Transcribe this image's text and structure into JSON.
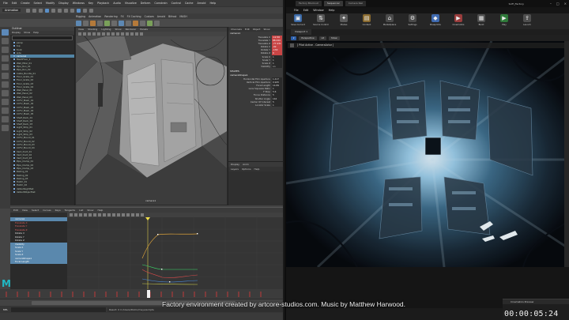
{
  "maya": {
    "menubar": [
      "File",
      "Edit",
      "Create",
      "Select",
      "Modify",
      "Display",
      "Windows",
      "Key",
      "Playback",
      "Audio",
      "Visualize",
      "Deform",
      "Constrain",
      "Control",
      "Cache",
      "Arnold",
      "Help"
    ],
    "mode_set": "Animation",
    "shelf_tabs": [
      "Rigging",
      "Animation",
      "Rendering",
      "FX",
      "FX Caching",
      "Custom",
      "Arnold",
      "Bifrost",
      "MASH"
    ],
    "outliner": {
      "title": "Outliner",
      "menu": [
        "Display",
        "Show",
        "Help"
      ],
      "rows": [
        {
          "label": "persp",
          "sel": false
        },
        {
          "label": "top",
          "sel": false
        },
        {
          "label": "front",
          "sel": false
        },
        {
          "label": "side",
          "sel": false
        },
        {
          "label": "camera1",
          "sel": true
        },
        {
          "label": "MeshFloor_1",
          "sel": false
        },
        {
          "label": "Wall_Pillar_01",
          "sel": false
        },
        {
          "label": "Pipe_Run_01",
          "sel": false
        },
        {
          "label": "Pipe_Run_02",
          "sel": false
        },
        {
          "label": "Cable_Bundle_01",
          "sel": false
        },
        {
          "label": "Floor_Grate_01",
          "sel": false
        },
        {
          "label": "Floor_Grate_02",
          "sel": false
        },
        {
          "label": "Floor_Grate_03",
          "sel": false
        },
        {
          "label": "Floor_Grate_04",
          "sel": false
        },
        {
          "label": "Wall_Panel_01",
          "sel": false
        },
        {
          "label": "Wall_Panel_02",
          "sel": false
        },
        {
          "label": "Wall_Panel_03",
          "sel": false
        },
        {
          "label": "CCTV_Mesh_01",
          "sel": false
        },
        {
          "label": "CCTV_Mesh_02",
          "sel": false
        },
        {
          "label": "CCTV_Mesh_03",
          "sel": false
        },
        {
          "label": "CCTV_Mesh_04",
          "sel": false
        },
        {
          "label": "CCTV_Mesh_05",
          "sel": false
        },
        {
          "label": "Shelf_Rack_01",
          "sel": false
        },
        {
          "label": "Shelf_Rack_02",
          "sel": false
        },
        {
          "label": "Shelf_Rack_03",
          "sel": false
        },
        {
          "label": "Light_Strip_01",
          "sel": false
        },
        {
          "label": "Light_Strip_02",
          "sel": false
        },
        {
          "label": "Light_Strip_03",
          "sel": false
        },
        {
          "label": "CCTV_Mount_01",
          "sel": false
        },
        {
          "label": "CCTV_Mount_02",
          "sel": false
        },
        {
          "label": "CCTV_Mount_03",
          "sel": false
        },
        {
          "label": "CCTV_Mount_04",
          "sel": false
        },
        {
          "label": "Vent_Duct_01",
          "sel": false
        },
        {
          "label": "Vent_Duct_02",
          "sel": false
        },
        {
          "label": "Vent_Duct_03",
          "sel": false
        },
        {
          "label": "Pipe_Clamp_01",
          "sel": false
        },
        {
          "label": "Pipe_Clamp_02",
          "sel": false
        },
        {
          "label": "Pipe_Clamp_03",
          "sel": false
        },
        {
          "label": "Railing_01",
          "sel": false
        },
        {
          "label": "Railing_02",
          "sel": false
        },
        {
          "label": "Railing_03",
          "sel": false
        },
        {
          "label": "Hatch_01",
          "sel": false
        },
        {
          "label": "Hatch_02",
          "sel": false
        },
        {
          "label": "defaultLightSet",
          "sel": false
        },
        {
          "label": "defaultObjectSet",
          "sel": false
        }
      ]
    },
    "viewport": {
      "menu": [
        "View",
        "Shading",
        "Lighting",
        "Show",
        "Renderer",
        "Panels"
      ],
      "camera_label": "camera1"
    },
    "channel_box": {
      "tabs": [
        "Channels",
        "Edit",
        "Object",
        "Show"
      ],
      "object": "camera1",
      "attrs": [
        {
          "name": "Translate X",
          "value": "-12.56",
          "key": true
        },
        {
          "name": "Translate Y",
          "value": "88.244",
          "key": true
        },
        {
          "name": "Translate Z",
          "value": "-77.231",
          "key": true
        },
        {
          "name": "Rotate X",
          "value": "-92",
          "key": true
        },
        {
          "name": "Rotate Y",
          "value": "-130",
          "key": true
        },
        {
          "name": "Rotate Z",
          "value": "0",
          "key": true
        },
        {
          "name": "Scale X",
          "value": "1",
          "key": false
        },
        {
          "name": "Scale Y",
          "value": "1",
          "key": false
        },
        {
          "name": "Scale Z",
          "value": "1",
          "key": false
        },
        {
          "name": "Visibility",
          "value": "on",
          "key": false
        }
      ],
      "shapes_label": "SHAPES",
      "shape_name": "cameraShape1",
      "shape_attrs": [
        {
          "name": "Horizontal Film Aperture",
          "value": "1.417"
        },
        {
          "name": "Vertical Film Aperture",
          "value": "0.945"
        },
        {
          "name": "Focal Length",
          "value": "14.89"
        },
        {
          "name": "Lens Squeeze Ratio",
          "value": "1"
        },
        {
          "name": "F Stop",
          "value": "5.6"
        },
        {
          "name": "Focus Distance",
          "value": "5"
        },
        {
          "name": "Shutter Angle",
          "value": "144"
        },
        {
          "name": "Center Of Interest",
          "value": "5"
        },
        {
          "name": "Locator Scale",
          "value": "1"
        }
      ],
      "layer_tabs": [
        "Display",
        "Anim"
      ],
      "layer_menu": [
        "Layers",
        "Options",
        "Help"
      ]
    },
    "graph_editor": {
      "menu": [
        "Edit",
        "View",
        "Select",
        "Curves",
        "Keys",
        "Tangents",
        "List",
        "Show",
        "Help"
      ],
      "rows": [
        {
          "label": "camera1",
          "style": "sel"
        },
        {
          "label": "Translate X",
          "style": "r"
        },
        {
          "label": "Translate Y",
          "style": "r"
        },
        {
          "label": "Translate Z",
          "style": "r"
        },
        {
          "label": "Rotate X",
          "style": ""
        },
        {
          "label": "Rotate Y",
          "style": ""
        },
        {
          "label": "Rotate Z",
          "style": ""
        },
        {
          "label": "Visibility",
          "style": "sel"
        },
        {
          "label": "Scale X",
          "style": "sel"
        },
        {
          "label": "Scale Y",
          "style": "sel"
        },
        {
          "label": "Scale Z",
          "style": "sel"
        },
        {
          "label": "cameraShape1",
          "style": "sel"
        },
        {
          "label": "Focal Length",
          "style": "sel"
        }
      ]
    },
    "command_result": "Result: 0 C:/Users/Public/maya/scripts",
    "logo": "M",
    "mel_label": "MEL"
  },
  "ue": {
    "tabs": [
      {
        "label": "Factory Blockout",
        "active": false
      },
      {
        "label": "Sequencer",
        "active": true
      },
      {
        "label": "Camera Rail",
        "active": false
      }
    ],
    "project": "SciFi_Factory",
    "menu": [
      "File",
      "Edit",
      "Window",
      "Help"
    ],
    "toolbar": [
      {
        "label": "Save Current",
        "icon": "save-icon",
        "color": "#3b6aa8",
        "glyph": "▣"
      },
      {
        "label": "Source Control",
        "icon": "source-control-icon",
        "color": "#555",
        "glyph": "⇅"
      },
      {
        "label": "Modes",
        "icon": "modes-icon",
        "color": "#5b5b5b",
        "glyph": "✦"
      },
      {
        "label": "Content",
        "icon": "content-icon",
        "color": "#8a6a2e",
        "glyph": "▤"
      },
      {
        "label": "Marketplace",
        "icon": "marketplace-icon",
        "color": "#4a4a4a",
        "glyph": "⌂"
      },
      {
        "label": "Settings",
        "icon": "settings-icon",
        "color": "#4a4a4a",
        "glyph": "⚙"
      },
      {
        "label": "Blueprints",
        "icon": "blueprints-icon",
        "color": "#3f6ab0",
        "glyph": "◆"
      },
      {
        "label": "Cinematics",
        "icon": "cinematics-icon",
        "color": "#9a3c3c",
        "glyph": "▶"
      },
      {
        "label": "Build",
        "icon": "build-icon",
        "color": "#4f4f4f",
        "glyph": "▦"
      },
      {
        "label": "Play",
        "icon": "play-icon",
        "color": "#2f7a3a",
        "glyph": "▶"
      },
      {
        "label": "Launch",
        "icon": "launch-icon",
        "color": "#4f4f4f",
        "glyph": "⇪"
      }
    ],
    "viewport_tab": "Viewport 1",
    "viewport_buttons": [
      "Perspective",
      "Lit",
      "Show"
    ],
    "pilot_label": "[ Pilot Active - CameraActor ]"
  },
  "sequencer": {
    "header": "Cinematics Preview",
    "timecode": "00:00:05:24"
  },
  "credit": "Factory environment created by artcore-studios.com. Music by Matthew Harwood."
}
